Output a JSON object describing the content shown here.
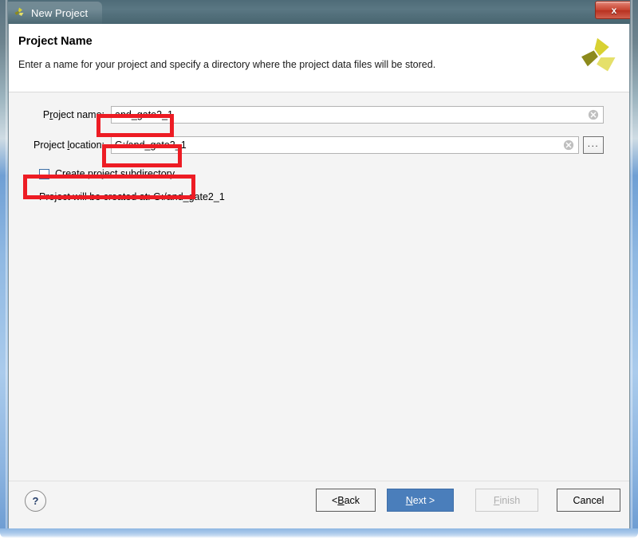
{
  "window": {
    "title": "New Project",
    "icon": "vivado-logo-icon",
    "close_label": "x"
  },
  "header": {
    "title": "Project Name",
    "subtitle": "Enter a name for your project and specify a directory where the project data files will be stored.",
    "logo": "vivado-logo"
  },
  "form": {
    "project_name": {
      "label_prefix": "P",
      "label_accel": "r",
      "label_suffix": "oject name:",
      "value": "and_gate2_1",
      "placeholder": "",
      "clear_icon": "clear-circle-icon"
    },
    "project_location": {
      "label_prefix": "Project ",
      "label_accel": "l",
      "label_suffix": "ocation:",
      "value": "G:/and_gate2_1",
      "placeholder": "",
      "clear_icon": "clear-circle-icon",
      "browse_label": "..."
    },
    "create_subdirectory": {
      "label": "Create project subdirectory",
      "checked": false
    },
    "created_at": "Project will be created at: G:/and_gate2_1"
  },
  "buttons": {
    "help": "?",
    "back_prefix": "< ",
    "back_accel": "B",
    "back_suffix": "ack",
    "next_accel": "N",
    "next_suffix": "ext >",
    "finish_accel": "F",
    "finish_suffix": "inish",
    "cancel": "Cancel"
  },
  "colors": {
    "accent_blue": "#4a7ebb",
    "titlebar": "#53707c",
    "annotation_red": "#ed1c24",
    "body_bg": "#f4f4f4",
    "close_red": "#c5422f"
  },
  "annotations": [
    {
      "name": "project-name-highlight"
    },
    {
      "name": "project-location-highlight"
    },
    {
      "name": "create-subdirectory-highlight"
    }
  ]
}
